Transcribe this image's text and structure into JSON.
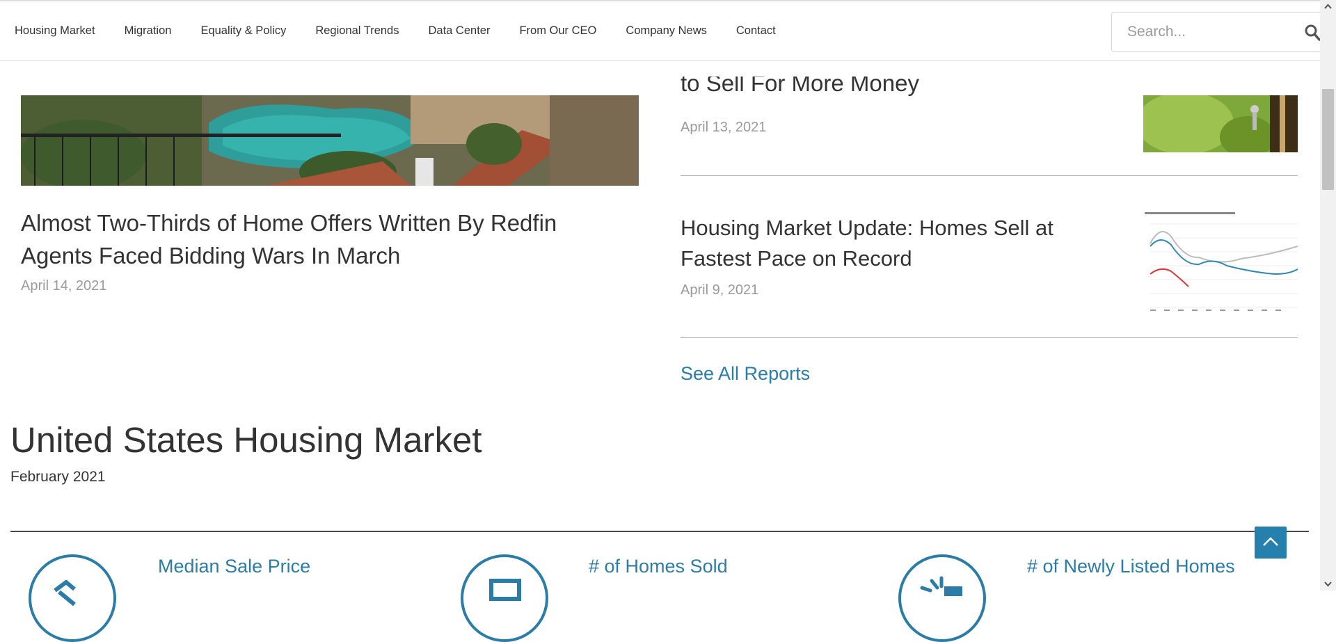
{
  "nav": {
    "items": [
      "Housing Market",
      "Migration",
      "Equality & Policy",
      "Regional Trends",
      "Data Center",
      "From Our CEO",
      "Company News",
      "Contact"
    ],
    "search_placeholder": "Search..."
  },
  "featured": {
    "title": "Almost Two-Thirds of Home Offers Written By Redfin Agents Faced Bidding Wars In March",
    "date": "April 14, 2021",
    "image": "pool-backyard-photo"
  },
  "reports": [
    {
      "title": "to Sell For More Money",
      "date": "April 13, 2021",
      "thumb": "house-keys-photo"
    },
    {
      "title": "Housing Market Update: Homes Sell at Fastest Pace on Record",
      "date": "April 9, 2021",
      "thumb": "line-chart-thumbnail"
    }
  ],
  "see_all": "See All Reports",
  "section": {
    "title": "United States Housing Market",
    "date": "February 2021",
    "metrics": [
      {
        "label": "Median Sale Price",
        "icon": "price-tag-house-icon"
      },
      {
        "label": "# of Homes Sold",
        "icon": "sold-sign-icon"
      },
      {
        "label": "# of Newly Listed Homes",
        "icon": "new-listing-icon"
      }
    ]
  },
  "colors": {
    "accent": "#2b7ca7",
    "text": "#333333",
    "muted": "#9a9a9a"
  }
}
